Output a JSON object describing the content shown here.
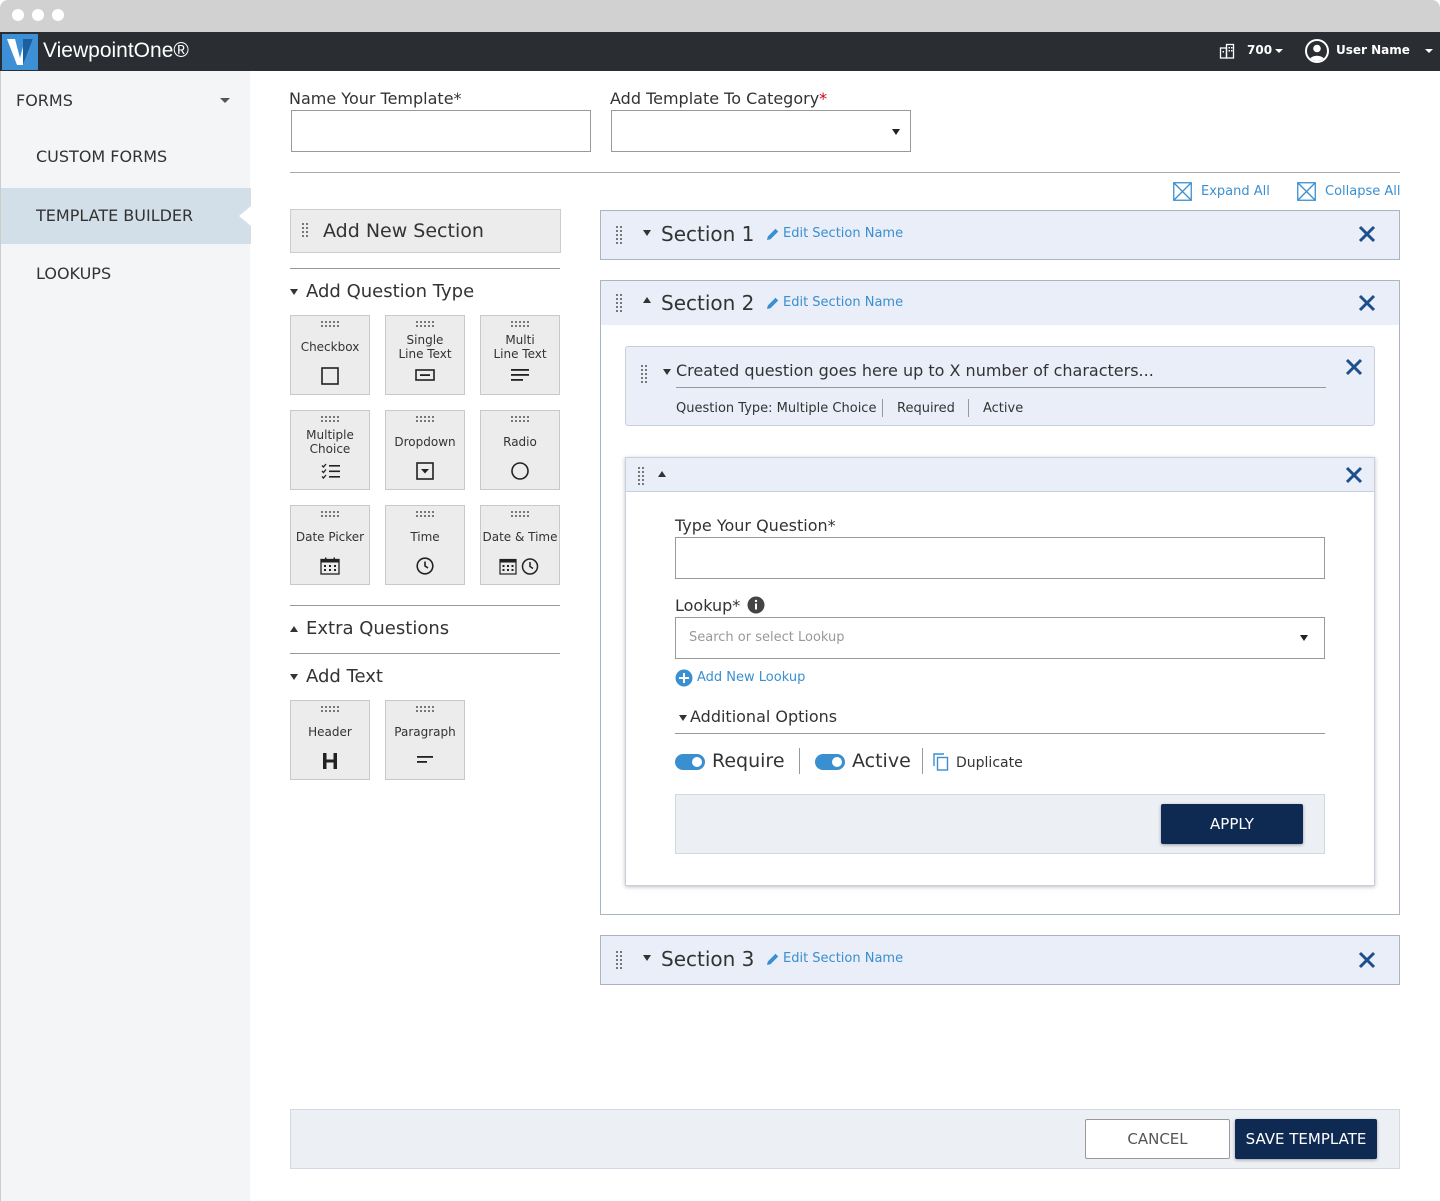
{
  "app": {
    "name": "ViewpointOne®"
  },
  "topbar": {
    "building_count": "700",
    "user_name": "User Name"
  },
  "sidebar": {
    "group_label": "FORMS",
    "items": [
      {
        "label": "CUSTOM FORMS",
        "active": false
      },
      {
        "label": "TEMPLATE BUILDER",
        "active": true
      },
      {
        "label": "LOOKUPS",
        "active": false
      }
    ]
  },
  "form": {
    "name_label": "Name Your Template*",
    "name_value": "",
    "category_label": "Add Template To Category",
    "category_required_mark": "*",
    "category_value": ""
  },
  "toolbar": {
    "expand_all": "Expand All",
    "collapse_all": "Collapse All"
  },
  "palette": {
    "add_new_section": "Add New Section",
    "question_type_heading": "Add Question Type",
    "question_types": [
      {
        "label": "Checkbox",
        "icon": "checkbox-icon"
      },
      {
        "label": "Single Line Text",
        "icon": "single-line-text-icon"
      },
      {
        "label": "Multi Line Text",
        "icon": "multi-line-text-icon"
      },
      {
        "label": "Multiple Choice",
        "icon": "multiple-choice-icon"
      },
      {
        "label": "Dropdown",
        "icon": "dropdown-icon"
      },
      {
        "label": "Radio",
        "icon": "radio-icon"
      },
      {
        "label": "Date Picker",
        "icon": "calendar-icon"
      },
      {
        "label": "Time",
        "icon": "clock-icon"
      },
      {
        "label": "Date & Time",
        "icon": "calendar-clock-icon"
      }
    ],
    "extra_questions_heading": "Extra Questions",
    "add_text_heading": "Add Text",
    "text_types": [
      {
        "label": "Header",
        "icon": "header-icon"
      },
      {
        "label": "Paragraph",
        "icon": "paragraph-icon"
      }
    ]
  },
  "sections": [
    {
      "title": "Section 1",
      "edit_label": "Edit Section Name",
      "expanded": false
    },
    {
      "title": "Section 2",
      "edit_label": "Edit Section Name",
      "expanded": true
    },
    {
      "title": "Section 3",
      "edit_label": "Edit Section Name",
      "expanded": false
    }
  ],
  "question_card": {
    "text": "Created question goes here up to X number of characters...",
    "type": "Question Type: Multiple Choice",
    "required": "Required",
    "status": "Active"
  },
  "question_editor": {
    "question_label": "Type Your Question*",
    "question_value": "",
    "lookup_label": "Lookup*",
    "lookup_placeholder": "Search or select Lookup",
    "add_lookup": "Add New Lookup",
    "additional_options": "Additional Options",
    "require_label": "Require",
    "require_on": true,
    "active_label": "Active",
    "active_on": true,
    "duplicate_label": "Duplicate",
    "apply_label": "APPLY"
  },
  "footer": {
    "cancel_label": "CANCEL",
    "save_label": "SAVE TEMPLATE"
  },
  "colors": {
    "accent": "#3a8fd0",
    "primary_button": "#0e2a52",
    "topbar": "#2a2d31",
    "section_bg": "#e9eef8"
  }
}
